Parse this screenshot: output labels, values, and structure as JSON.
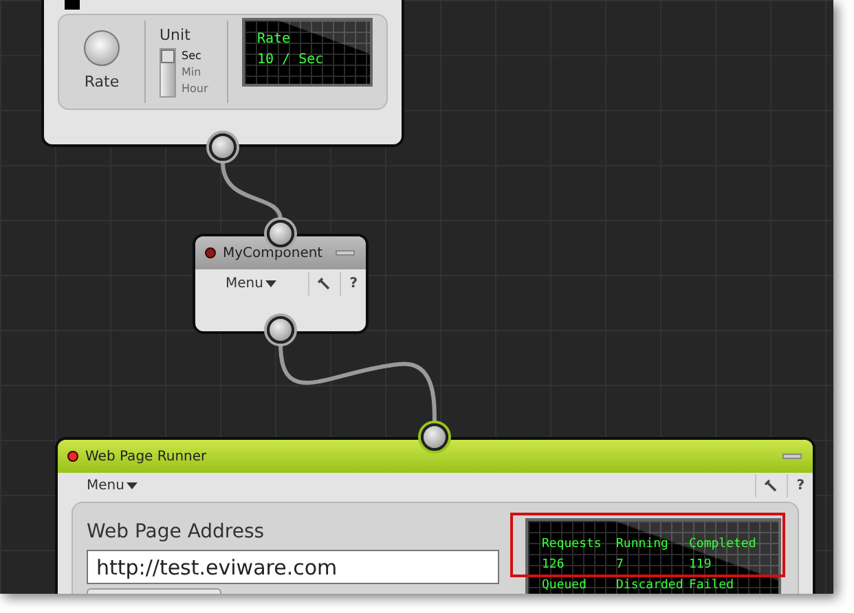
{
  "nodes": [
    {
      "kind": "rate",
      "knob": {
        "label": "Rate"
      },
      "unit": {
        "title": "Unit",
        "options": [
          {
            "label": "Sec",
            "selected": true
          },
          {
            "label": "Min",
            "selected": false
          },
          {
            "label": "Hour",
            "selected": false
          }
        ]
      },
      "display": {
        "lines": [
          "Rate",
          "10 / Sec"
        ]
      }
    },
    {
      "kind": "component",
      "title": "MyComponent",
      "selected": false,
      "color": "#8a1c1c",
      "menu": "Menu",
      "help": "?"
    },
    {
      "kind": "runner",
      "title": "Web Page Runner",
      "selected": true,
      "color": "#e82a2a",
      "menu": "Menu",
      "help": "?",
      "address": {
        "label": "Web Page Address",
        "value": "http://test.eviware.com"
      },
      "highlighted": true,
      "stats": [
        {
          "label": "Requests",
          "value": "126"
        },
        {
          "label": "Running",
          "value": "7"
        },
        {
          "label": "Completed",
          "value": "119"
        },
        {
          "label": "Queued"
        },
        {
          "label": "Discarded"
        },
        {
          "label": "Failed"
        }
      ]
    }
  ]
}
